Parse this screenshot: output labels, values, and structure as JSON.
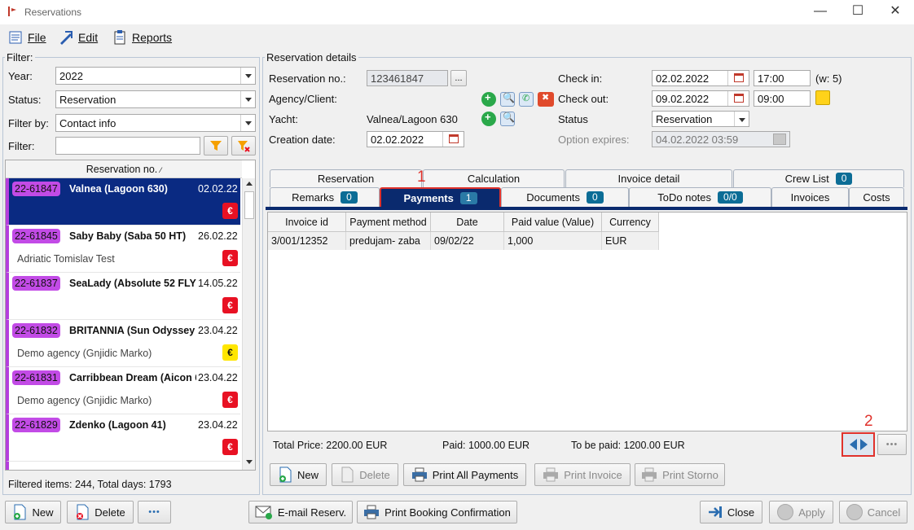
{
  "window": {
    "title": "Reservations"
  },
  "menu": {
    "file": "File",
    "edit": "Edit",
    "reports": "Reports"
  },
  "filter": {
    "legend": "Filter:",
    "year_label": "Year:",
    "year_value": "2022",
    "status_label": "Status:",
    "status_value": "Reservation",
    "filter_by_label": "Filter by:",
    "filter_by_value": "Contact info",
    "filter_label": "Filter:",
    "filter_value": ""
  },
  "list": {
    "header": "Reservation no.",
    "items": [
      {
        "no": "22-61847",
        "yacht": "Valnea (Lagoon 630)",
        "date": "02.02.22",
        "sub": "",
        "pay": "red"
      },
      {
        "no": "22-61845",
        "yacht": "Saby Baby (Saba 50 HT)",
        "date": "26.02.22",
        "sub": "Adriatic Tomislav Test",
        "pay": "red"
      },
      {
        "no": "22-61837",
        "yacht": "SeaLady (Absolute 52 FLY",
        "date": "14.05.22",
        "sub": "",
        "pay": "red"
      },
      {
        "no": "22-61832",
        "yacht": "BRITANNIA (Sun Odyssey",
        "date": "23.04.22",
        "sub": "Demo agency (Gnjidic Marko)",
        "pay": "yellow"
      },
      {
        "no": "22-61831",
        "yacht": "Carribbean Dream (Aicon 6",
        "date": "23.04.22",
        "sub": "Demo agency (Gnjidic Marko)",
        "pay": "red"
      },
      {
        "no": "22-61829",
        "yacht": "Zdenko (Lagoon 41)",
        "date": "23.04.22",
        "sub": "",
        "pay": "red"
      }
    ],
    "euro": "€",
    "summary": "Filtered items:  244,  Total days: 1793"
  },
  "details": {
    "legend": "Reservation details",
    "res_no_label": "Reservation no.:",
    "res_no_value": "123461847",
    "res_no_btn": "...",
    "agency_label": "Agency/Client:",
    "yacht_label": "Yacht:",
    "yacht_value": "Valnea/Lagoon 630",
    "creation_label": "Creation date:",
    "creation_value": "02.02.2022",
    "checkin_label": "Check in:",
    "checkin_date": "02.02.2022",
    "checkin_time": "17:00",
    "checkin_week": "(w: 5)",
    "checkout_label": "Check out:",
    "checkout_date": "09.02.2022",
    "checkout_time": "09:00",
    "status_label": "Status",
    "status_value": "Reservation",
    "option_label": "Option expires:",
    "option_value": "04.02.2022 03:59"
  },
  "tabs": {
    "row1": [
      {
        "label": "Reservation",
        "badge": ""
      },
      {
        "label": "Calculation",
        "badge": ""
      },
      {
        "label": "Invoice detail",
        "badge": ""
      },
      {
        "label": "Crew List",
        "badge": "0"
      }
    ],
    "row2": [
      {
        "label": "Remarks",
        "badge": "0"
      },
      {
        "label": "Payments",
        "badge": "1"
      },
      {
        "label": "Documents",
        "badge": "0"
      },
      {
        "label": "ToDo notes",
        "badge": "0/0"
      },
      {
        "label": "Invoices",
        "badge": ""
      },
      {
        "label": "Costs",
        "badge": ""
      }
    ]
  },
  "annotations": {
    "one": "1",
    "two": "2"
  },
  "payments": {
    "columns": [
      "Invoice id",
      "Payment method",
      "Date",
      "Paid value (Value)",
      "Currency"
    ],
    "rows": [
      [
        "3/001/12352",
        "predujam- zaba",
        "09/02/22",
        "1,000",
        "EUR"
      ]
    ],
    "total_price": "Total Price: 2200.00 EUR",
    "paid": "Paid: 1000.00 EUR",
    "to_be_paid": "To be paid: 1200.00 EUR",
    "more": "•••"
  },
  "payment_buttons": {
    "new": "New",
    "delete": "Delete",
    "print_all": "Print All Payments",
    "print_invoice": "Print Invoice",
    "print_storno": "Print Storno"
  },
  "footer": {
    "new": "New",
    "delete": "Delete",
    "more": "•••",
    "email": "E-mail Reserv.",
    "print_booking": "Print Booking Confirmation",
    "close": "Close",
    "apply": "Apply",
    "cancel": "Cancel"
  }
}
